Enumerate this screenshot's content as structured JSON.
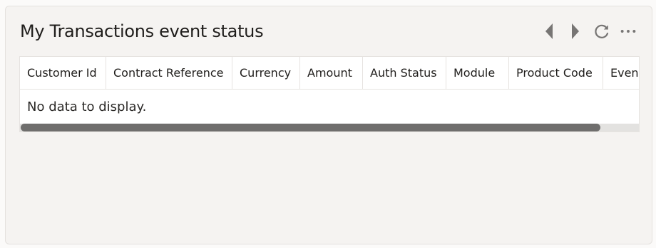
{
  "widget": {
    "title": "My Transactions event status"
  },
  "toolbar": {
    "icons": [
      "chevron-left-icon",
      "chevron-right-icon",
      "refresh-icon",
      "more-options-icon"
    ],
    "icon_color": "#777574"
  },
  "table": {
    "columns": [
      "Customer Id",
      "Contract Reference",
      "Currency",
      "Amount",
      "Auth Status",
      "Module",
      "Product Code",
      "Event"
    ],
    "empty_message": "No data to display."
  },
  "colors": {
    "card_background": "#f5f3f1",
    "grid_background": "#ffffff",
    "scrollbar_thumb": "#6f6e6d",
    "scrollbar_track": "#e3e2e0"
  }
}
